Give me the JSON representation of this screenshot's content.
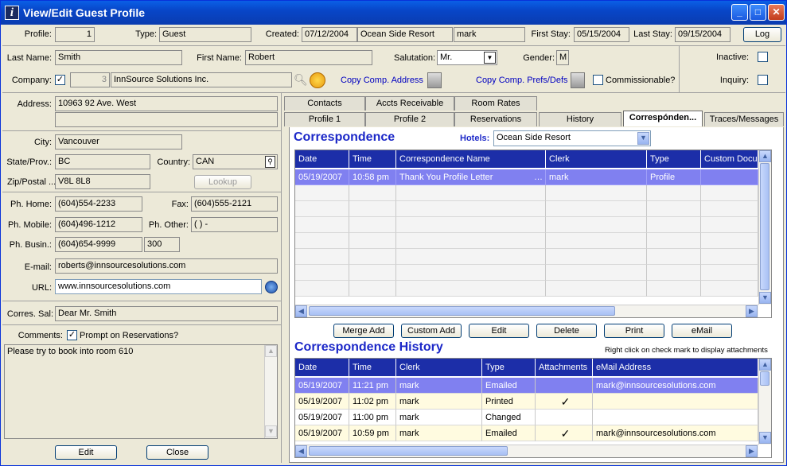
{
  "window": {
    "title": "View/Edit Guest Profile"
  },
  "top": {
    "profile_label": "Profile:",
    "profile": "1",
    "type_label": "Type:",
    "type": "Guest",
    "created_label": "Created:",
    "created_date": "07/12/2004",
    "created_hotel": "Ocean Side Resort",
    "created_clerk": "mark",
    "first_stay_label": "First Stay:",
    "first_stay": "05/15/2004",
    "last_stay_label": "Last Stay:",
    "last_stay": "09/15/2004",
    "log_button": "Log"
  },
  "name": {
    "last_label": "Last Name:",
    "last": "Smith",
    "first_label": "First Name:",
    "first": "Robert",
    "salutation_label": "Salutation:",
    "salutation": "Mr.",
    "gender_label": "Gender:",
    "gender": "M",
    "inactive_label": "Inactive:",
    "inquiry_label": "Inquiry:"
  },
  "company": {
    "label": "Company:",
    "checked": "✓",
    "id": "3",
    "name": "InnSource Solutions Inc.",
    "copy_address": "Copy Comp. Address",
    "copy_prefs": "Copy Comp. Prefs/Defs",
    "commissionable": "Commissionable?"
  },
  "address": {
    "label": "Address:",
    "line1": "10963 92 Ave. West",
    "line2": "",
    "city_label": "City:",
    "city": "Vancouver",
    "state_label": "State/Prov.:",
    "state": "BC",
    "country_label": "Country:",
    "country": "CAN",
    "zip_label": "Zip/Postal ...",
    "zip": "V8L 8L8",
    "lookup": "Lookup"
  },
  "phones": {
    "home_label": "Ph. Home:",
    "home": "(604)554-2233",
    "fax_label": "Fax:",
    "fax": "(604)555-2121",
    "mobile_label": "Ph. Mobile:",
    "mobile": "(604)496-1212",
    "other_label": "Ph. Other:",
    "other": "(   )   -",
    "busin_label": "Ph. Busin.:",
    "busin": "(604)654-9999",
    "ext": "300"
  },
  "contact": {
    "email_label": "E-mail:",
    "email": "roberts@innsourcesolutions.com",
    "url_label": "URL:",
    "url": "www.innsourcesolutions.com",
    "corres_label": "Corres. Sal:",
    "corres": "Dear Mr. Smith"
  },
  "comments": {
    "label": "Comments:",
    "checked": "✓",
    "prompt": "Prompt on Reservations?",
    "text": "Please try to book into room 610"
  },
  "bottom": {
    "edit": "Edit",
    "close": "Close"
  },
  "tabs": {
    "row1": [
      "Contacts",
      "Accts Receivable",
      "Room Rates"
    ],
    "row2": [
      "Profile 1",
      "Profile 2",
      "Reservations",
      "History",
      "Correspónden...",
      "Traces/Messages"
    ]
  },
  "correspondence": {
    "title": "Correspondence",
    "hotels_label": "Hotels:",
    "hotel": "Ocean Side Resort",
    "columns": [
      "Date",
      "Time",
      "Correspondence Name",
      "Clerk",
      "Type",
      "Custom Docu"
    ],
    "rows": [
      [
        "05/19/2007",
        "10:58 pm",
        "Thank You Profile Letter",
        "mark",
        "Profile",
        ""
      ]
    ],
    "buttons": [
      "Merge Add",
      "Custom Add",
      "Edit",
      "Delete",
      "Print",
      "eMail"
    ]
  },
  "history": {
    "title": "Correspondence History",
    "hint": "Right click on check mark to display attachments",
    "columns": [
      "Date",
      "Time",
      "Clerk",
      "Type",
      "Attachments",
      "eMail Address"
    ],
    "rows": [
      [
        "05/19/2007",
        "11:21 pm",
        "mark",
        "Emailed",
        "",
        "mark@innsourcesolutions.com"
      ],
      [
        "05/19/2007",
        "11:02 pm",
        "mark",
        "Printed",
        "✓",
        ""
      ],
      [
        "05/19/2007",
        "11:00 pm",
        "mark",
        "Changed",
        "",
        ""
      ],
      [
        "05/19/2007",
        "10:59 pm",
        "mark",
        "Emailed",
        "✓",
        "mark@innsourcesolutions.com"
      ]
    ]
  }
}
